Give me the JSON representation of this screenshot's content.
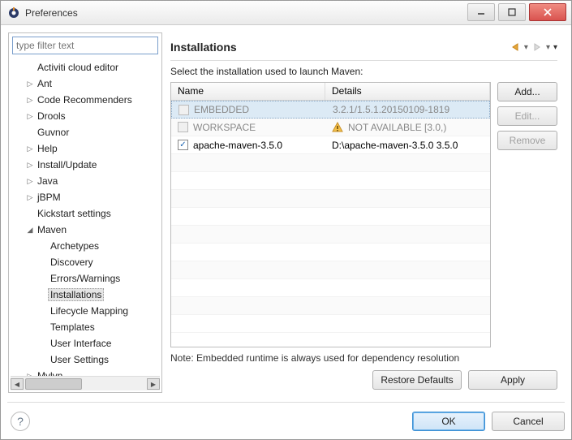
{
  "window": {
    "title": "Preferences"
  },
  "filter": {
    "placeholder": "type filter text"
  },
  "tree": {
    "items": [
      {
        "label": "Activiti cloud editor",
        "indent": 1,
        "exp": ""
      },
      {
        "label": "Ant",
        "indent": 1,
        "exp": "▷"
      },
      {
        "label": "Code Recommenders",
        "indent": 1,
        "exp": "▷"
      },
      {
        "label": "Drools",
        "indent": 1,
        "exp": "▷"
      },
      {
        "label": "Guvnor",
        "indent": 1,
        "exp": ""
      },
      {
        "label": "Help",
        "indent": 1,
        "exp": "▷"
      },
      {
        "label": "Install/Update",
        "indent": 1,
        "exp": "▷"
      },
      {
        "label": "Java",
        "indent": 1,
        "exp": "▷"
      },
      {
        "label": "jBPM",
        "indent": 1,
        "exp": "▷"
      },
      {
        "label": "Kickstart settings",
        "indent": 1,
        "exp": ""
      },
      {
        "label": "Maven",
        "indent": 1,
        "exp": "◢"
      },
      {
        "label": "Archetypes",
        "indent": 2,
        "exp": ""
      },
      {
        "label": "Discovery",
        "indent": 2,
        "exp": ""
      },
      {
        "label": "Errors/Warnings",
        "indent": 2,
        "exp": ""
      },
      {
        "label": "Installations",
        "indent": 2,
        "exp": "",
        "selected": true
      },
      {
        "label": "Lifecycle Mapping",
        "indent": 2,
        "exp": ""
      },
      {
        "label": "Templates",
        "indent": 2,
        "exp": ""
      },
      {
        "label": "User Interface",
        "indent": 2,
        "exp": ""
      },
      {
        "label": "User Settings",
        "indent": 2,
        "exp": ""
      },
      {
        "label": "Mylyn",
        "indent": 1,
        "exp": "▷"
      }
    ]
  },
  "page": {
    "heading": "Installations",
    "description": "Select the installation used to launch Maven:",
    "columns": {
      "name": "Name",
      "details": "Details"
    },
    "rows": [
      {
        "checked": false,
        "disabled": true,
        "name": "EMBEDDED",
        "details": "3.2.1/1.5.1.20150109-1819",
        "grey": true,
        "selected": true
      },
      {
        "checked": false,
        "disabled": true,
        "name": "WORKSPACE",
        "details": "NOT AVAILABLE [3.0,)",
        "grey": true,
        "warn": true
      },
      {
        "checked": true,
        "disabled": false,
        "name": "apache-maven-3.5.0",
        "details": "D:\\apache-maven-3.5.0 3.5.0"
      }
    ],
    "buttons": {
      "add": "Add...",
      "edit": "Edit...",
      "remove": "Remove"
    },
    "note": "Note: Embedded runtime is always used for dependency resolution",
    "restore": "Restore Defaults",
    "apply": "Apply"
  },
  "footer": {
    "ok": "OK",
    "cancel": "Cancel"
  }
}
